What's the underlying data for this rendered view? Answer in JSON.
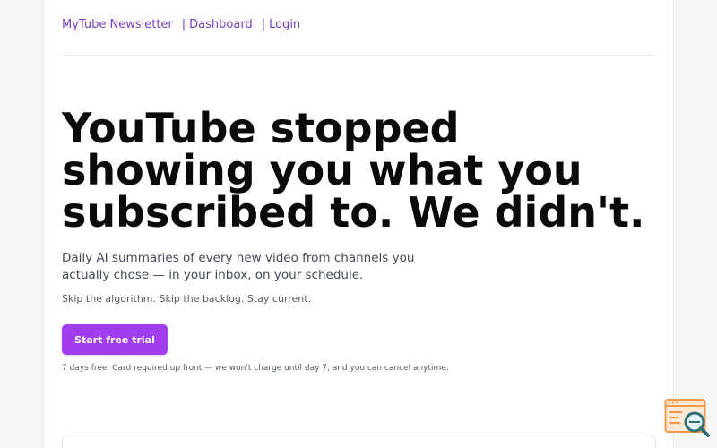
{
  "nav": {
    "brand": "MyTube Newsletter",
    "separator": "|",
    "dashboard": "Dashboard",
    "login": "Login"
  },
  "hero": {
    "headline": "YouTube stopped showing you what you subscribed to. We didn't.",
    "subhead": "Daily AI summaries of every new video from channels you actually chose — in your inbox, on your schedule.",
    "tagline": "Skip the algorithm. Skip the backlog. Stay current.",
    "cta_label": "Start free trial",
    "fineprint": "7 days free. Card required up front — we won't charge until day 7, and you can cancel anytime."
  },
  "widget": {
    "icon": "browser-search-icon"
  },
  "colors": {
    "accent": "#a13ef0",
    "link": "#7b3fc4",
    "widget_orange": "#f39a4a",
    "widget_teal": "#2f6f73"
  }
}
